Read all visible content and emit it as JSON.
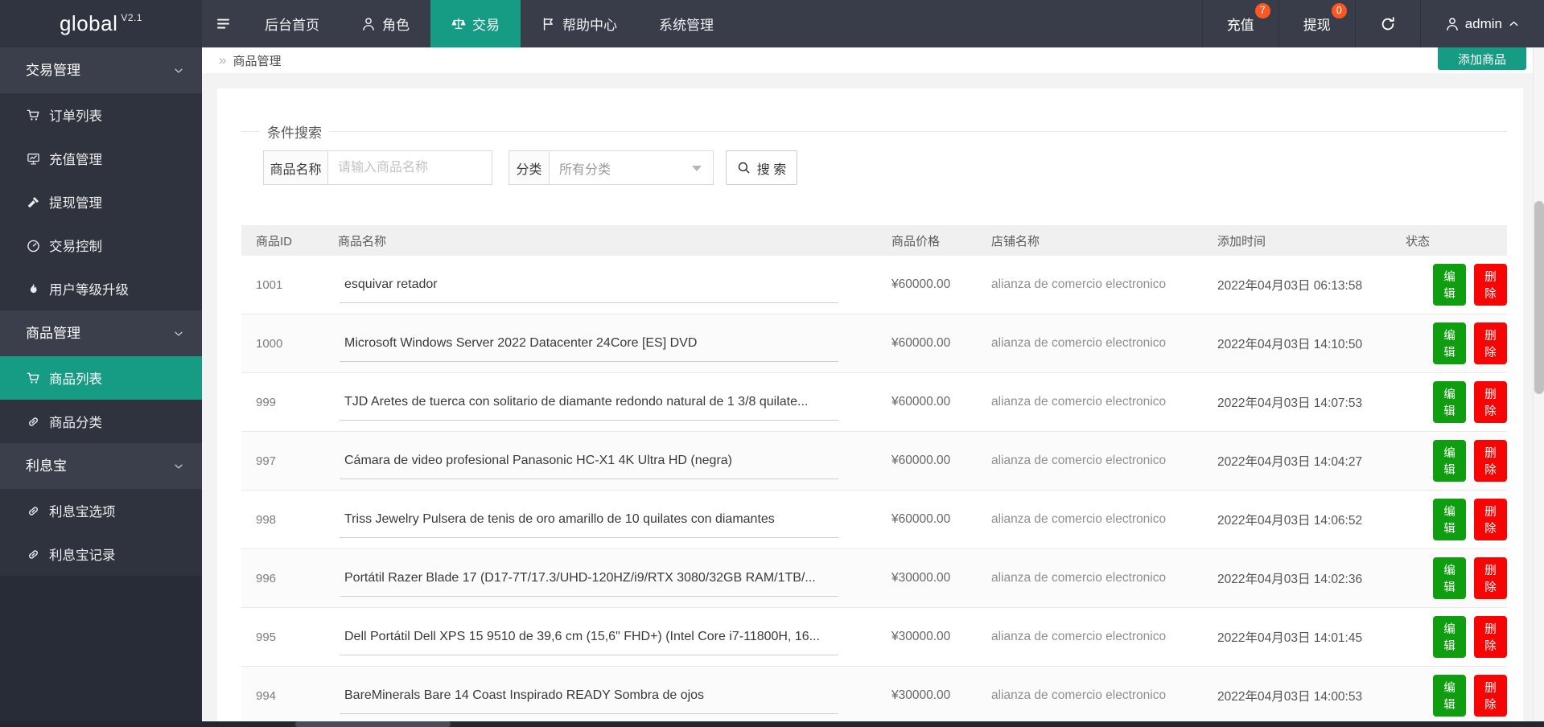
{
  "brand": {
    "name": "global",
    "version": "V2.1"
  },
  "navbar": {
    "items": [
      {
        "label": "后台首页"
      },
      {
        "label": "角色"
      },
      {
        "label": "交易"
      },
      {
        "label": "帮助中心"
      },
      {
        "label": "系统管理"
      }
    ],
    "recharge": {
      "label": "充值",
      "badge": "7"
    },
    "withdraw": {
      "label": "提现",
      "badge": "0"
    },
    "user": {
      "name": "admin"
    }
  },
  "sidebar": {
    "groups": [
      {
        "label": "交易管理",
        "items": [
          {
            "label": "订单列表"
          },
          {
            "label": "充值管理"
          },
          {
            "label": "提现管理"
          },
          {
            "label": "交易控制"
          },
          {
            "label": "用户等级升级"
          }
        ]
      },
      {
        "label": "商品管理",
        "items": [
          {
            "label": "商品列表"
          },
          {
            "label": "商品分类"
          }
        ]
      },
      {
        "label": "利息宝",
        "items": [
          {
            "label": "利息宝选项"
          },
          {
            "label": "利息宝记录"
          }
        ]
      }
    ]
  },
  "breadcrumb": {
    "symbol": "»",
    "label": "商品管理"
  },
  "toolbar": {
    "add_label": "添加商品"
  },
  "search": {
    "legend": "条件搜索",
    "name_label": "商品名称",
    "name_placeholder": "请输入商品名称",
    "category_label": "分类",
    "category_value": "所有分类",
    "button_label": "搜 索"
  },
  "table": {
    "columns": [
      "商品ID",
      "商品名称",
      "商品价格",
      "店铺名称",
      "添加时间",
      "状态"
    ],
    "edit_label": "编辑",
    "delete_label": "删除",
    "rows": [
      {
        "id": "1001",
        "name": "esquivar retador",
        "price": "¥60000.00",
        "store": "alianza de comercio electronico",
        "time": "2022年04月03日 06:13:58"
      },
      {
        "id": "1000",
        "name": "Microsoft Windows Server 2022 Datacenter 24Core [ES] DVD",
        "price": "¥60000.00",
        "store": "alianza de comercio electronico",
        "time": "2022年04月03日 14:10:50"
      },
      {
        "id": "999",
        "name": "TJD Aretes de tuerca con solitario de diamante redondo natural de 1 3/8 quilate...",
        "price": "¥60000.00",
        "store": "alianza de comercio electronico",
        "time": "2022年04月03日 14:07:53"
      },
      {
        "id": "997",
        "name": "Cámara de video profesional Panasonic HC-X1 4K Ultra HD (negra)",
        "price": "¥60000.00",
        "store": "alianza de comercio electronico",
        "time": "2022年04月03日 14:04:27"
      },
      {
        "id": "998",
        "name": "Triss Jewelry Pulsera de tenis de oro amarillo de 10 quilates con diamantes",
        "price": "¥60000.00",
        "store": "alianza de comercio electronico",
        "time": "2022年04月03日 14:06:52"
      },
      {
        "id": "996",
        "name": "Portátil Razer Blade 17 (D17-7T/17.3/UHD-120HZ/i9/RTX 3080/32GB RAM/1TB/...",
        "price": "¥30000.00",
        "store": "alianza de comercio electronico",
        "time": "2022年04月03日 14:02:36"
      },
      {
        "id": "995",
        "name": "Dell Portátil Dell XPS 15 9510 de 39,6 cm (15,6\" FHD+) (Intel Core i7-11800H, 16...",
        "price": "¥30000.00",
        "store": "alianza de comercio electronico",
        "time": "2022年04月03日 14:01:45"
      },
      {
        "id": "994",
        "name": "BareMinerals Bare 14 Coast Inspirado READY Sombra de ojos",
        "price": "¥30000.00",
        "store": "alianza de comercio electronico",
        "time": "2022年04月03日 14:00:53"
      }
    ]
  },
  "colors": {
    "accent": "#169c85",
    "edit_green": "#0f9e0f",
    "delete_red": "#f70505",
    "badge": "#ff5722"
  }
}
